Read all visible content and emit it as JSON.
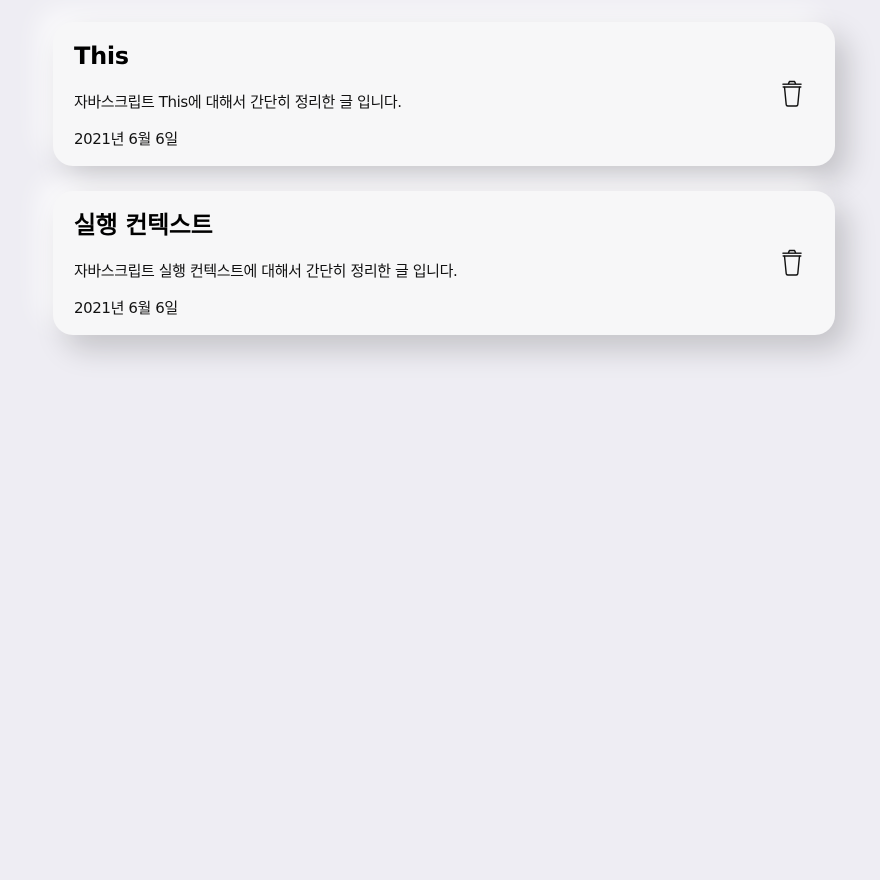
{
  "posts": [
    {
      "title": "This",
      "description": "자바스크립트 This에 대해서 간단히 정리한 글 입니다.",
      "date": "2021년 6월 6일",
      "delete_icon": "trash-icon"
    },
    {
      "title": "실행 컨텍스트",
      "description": "자바스크립트 실행 컨텍스트에 대해서 간단히 정리한 글 입니다.",
      "date": "2021년 6월 6일",
      "delete_icon": "trash-icon"
    }
  ]
}
